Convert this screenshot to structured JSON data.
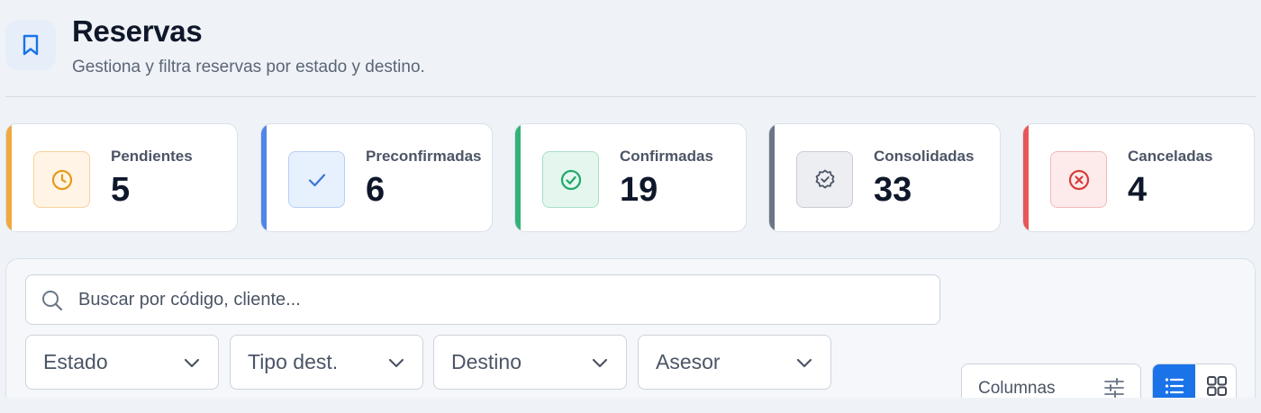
{
  "header": {
    "title": "Reservas",
    "subtitle": "Gestiona y filtra reservas por estado y destino.",
    "icon": "bookmark-icon"
  },
  "stats": [
    {
      "label": "Pendientes",
      "count": "5",
      "icon": "clock-icon",
      "accent": "#f0a93b",
      "icon_bg": "#fff4e5",
      "icon_border": "#f6d39b",
      "icon_color": "#e69a1c"
    },
    {
      "label": "Preconfirmadas",
      "count": "6",
      "icon": "check-icon",
      "accent": "#4f86e8",
      "icon_bg": "#e7f0fd",
      "icon_border": "#b8cff3",
      "icon_color": "#3b73d8"
    },
    {
      "label": "Confirmadas",
      "count": "19",
      "icon": "check-circle-icon",
      "accent": "#34b27a",
      "icon_bg": "#e5f6ee",
      "icon_border": "#a9e0c6",
      "icon_color": "#1ea86a"
    },
    {
      "label": "Consolidadas",
      "count": "33",
      "icon": "verified-badge-icon",
      "accent": "#6b7686",
      "icon_bg": "#eceef1",
      "icon_border": "#c8cdd4",
      "icon_color": "#4b5566"
    },
    {
      "label": "Canceladas",
      "count": "4",
      "icon": "x-circle-icon",
      "accent": "#e85656",
      "icon_bg": "#fdebeb",
      "icon_border": "#f3b9b9",
      "icon_color": "#d83b3b"
    }
  ],
  "filters": {
    "search_placeholder": "Buscar por código, cliente...",
    "search_value": "",
    "selects": [
      "Estado",
      "Tipo dest.",
      "Destino",
      "Asesor"
    ],
    "columns_label": "Columnas",
    "view_mode": "list"
  },
  "colors": {
    "primary": "#1a73e8",
    "page_bg": "#eff3f7"
  }
}
